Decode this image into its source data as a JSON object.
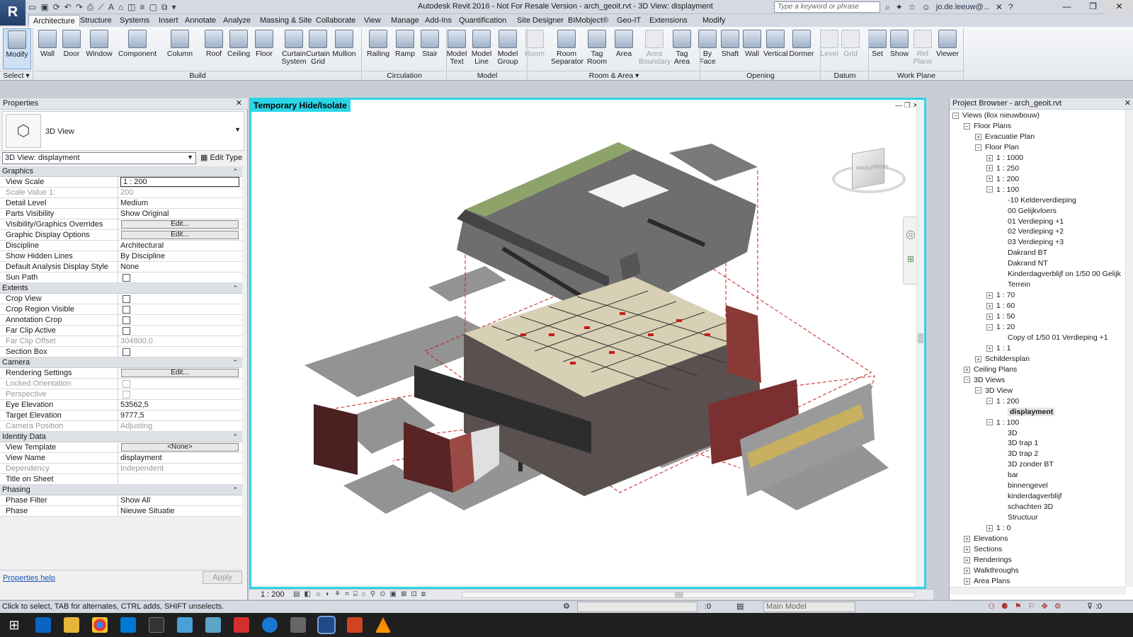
{
  "app": {
    "logo_letter": "R",
    "title": "Autodesk Revit 2016 - Not For Resale Version -    arch_geoit.rvt - 3D View: displayment",
    "search_placeholder": "Type a keyword or phrase",
    "user": "jo.de.leeuw@..."
  },
  "tabs": [
    "Architecture",
    "Structure",
    "Systems",
    "Insert",
    "Annotate",
    "Analyze",
    "Massing & Site",
    "Collaborate",
    "View",
    "Manage",
    "Add-Ins",
    "Quantification",
    "Site Designer",
    "BIMobject®",
    "Geo-IT",
    "Extensions",
    "Modify"
  ],
  "ribbon": {
    "buttons": [
      {
        "label": "Modify",
        "sel": true
      },
      {
        "label": "Wall"
      },
      {
        "label": "Door"
      },
      {
        "label": "Window"
      },
      {
        "label": "Component"
      },
      {
        "label": "Column"
      },
      {
        "label": "Roof"
      },
      {
        "label": "Ceiling"
      },
      {
        "label": "Floor"
      },
      {
        "label": "Curtain\nSystem"
      },
      {
        "label": "Curtain\nGrid"
      },
      {
        "label": "Mullion"
      },
      {
        "label": "Railing"
      },
      {
        "label": "Ramp"
      },
      {
        "label": "Stair"
      },
      {
        "label": "Model\nText"
      },
      {
        "label": "Model\nLine"
      },
      {
        "label": "Model\nGroup"
      },
      {
        "label": "Room",
        "dis": true
      },
      {
        "label": "Room\nSeparator"
      },
      {
        "label": "Tag\nRoom"
      },
      {
        "label": "Area"
      },
      {
        "label": "Area\nBoundary",
        "dis": true
      },
      {
        "label": "Tag\nArea"
      },
      {
        "label": "By\nFace"
      },
      {
        "label": "Shaft"
      },
      {
        "label": "Wall"
      },
      {
        "label": "Vertical"
      },
      {
        "label": "Dormer"
      },
      {
        "label": "Level",
        "dis": true
      },
      {
        "label": "Grid",
        "dis": true
      },
      {
        "label": "Set"
      },
      {
        "label": "Show"
      },
      {
        "label": "Ref\nPlane",
        "dis": true
      },
      {
        "label": "Viewer"
      }
    ],
    "panels": [
      "Select ▾",
      "Build",
      "Circulation",
      "Model",
      "Room & Area ▾",
      "Opening",
      "Datum",
      "Work Plane"
    ]
  },
  "properties": {
    "title": "Properties",
    "type_name": "3D View",
    "selector": "3D View: displayment",
    "edit_type": "Edit Type",
    "sections": {
      "graphics": "Graphics",
      "extents": "Extents",
      "camera": "Camera",
      "identity": "Identity Data",
      "phasing": "Phasing"
    },
    "rows": {
      "view_scale": [
        "View Scale",
        "1 : 200"
      ],
      "scale_value": [
        "Scale Value    1:",
        "200"
      ],
      "detail_level": [
        "Detail Level",
        "Medium"
      ],
      "parts_visibility": [
        "Parts Visibility",
        "Show Original"
      ],
      "vg_overrides": [
        "Visibility/Graphics Overrides",
        "Edit..."
      ],
      "gd_options": [
        "Graphic Display Options",
        "Edit..."
      ],
      "discipline": [
        "Discipline",
        "Architectural"
      ],
      "hidden_lines": [
        "Show Hidden Lines",
        "By Discipline"
      ],
      "analysis_style": [
        "Default Analysis Display Style",
        "None"
      ],
      "sun_path": [
        "Sun Path",
        ""
      ],
      "crop_view": [
        "Crop View",
        ""
      ],
      "crop_region": [
        "Crop Region Visible",
        ""
      ],
      "annotation_crop": [
        "Annotation Crop",
        ""
      ],
      "far_clip_active": [
        "Far Clip Active",
        ""
      ],
      "far_clip_offset": [
        "Far Clip Offset",
        "304800,0"
      ],
      "section_box": [
        "Section Box",
        ""
      ],
      "rendering": [
        "Rendering Settings",
        "Edit..."
      ],
      "locked_orient": [
        "Locked Orientation",
        ""
      ],
      "perspective": [
        "Perspective",
        ""
      ],
      "eye_elev": [
        "Eye Elevation",
        "53562,5"
      ],
      "target_elev": [
        "Target Elevation",
        "9777,5"
      ],
      "camera_pos": [
        "Camera Position",
        "Adjusting"
      ],
      "view_template": [
        "View Template",
        "<None>"
      ],
      "view_name": [
        "View Name",
        "displayment"
      ],
      "dependency": [
        "Dependency",
        "Independent"
      ],
      "title_sheet": [
        "Title on Sheet",
        ""
      ],
      "phase_filter": [
        "Phase Filter",
        "Show All"
      ],
      "phase": [
        "Phase",
        "Nieuwe Situatie"
      ]
    },
    "help": "Properties help",
    "apply": "Apply"
  },
  "viewport": {
    "label": "Temporary Hide/Isolate",
    "scale": "1 : 200",
    "cube_front": "FRONT",
    "cube_right": "RIGHT"
  },
  "browser": {
    "title": "Project Browser - arch_geoit.rvt",
    "nodes": [
      {
        "t": "Views (llox nieuwbouw)",
        "d": 0,
        "pm": "−"
      },
      {
        "t": "Floor Plans",
        "d": 1,
        "pm": "−"
      },
      {
        "t": "Evacuatie Plan",
        "d": 2,
        "pm": "+"
      },
      {
        "t": "Floor Plan",
        "d": 2,
        "pm": "−"
      },
      {
        "t": "1 : 1000",
        "d": 3,
        "pm": "+"
      },
      {
        "t": "1 : 250",
        "d": 3,
        "pm": "+"
      },
      {
        "t": "1 : 200",
        "d": 3,
        "pm": "+"
      },
      {
        "t": "1 : 100",
        "d": 3,
        "pm": "−"
      },
      {
        "t": "-10 Kelderverdieping",
        "d": 4
      },
      {
        "t": "00 Gelijkvloers",
        "d": 4
      },
      {
        "t": "01 Verdieping +1",
        "d": 4
      },
      {
        "t": "02 Verdieping +2",
        "d": 4
      },
      {
        "t": "03 Verdieping +3",
        "d": 4
      },
      {
        "t": "Dakrand BT",
        "d": 4
      },
      {
        "t": "Dakrand NT",
        "d": 4
      },
      {
        "t": "Kinderdagverblijf on 1/50 00 Gelijk",
        "d": 4
      },
      {
        "t": "Terrein",
        "d": 4
      },
      {
        "t": "1 : 70",
        "d": 3,
        "pm": "+"
      },
      {
        "t": "1 : 60",
        "d": 3,
        "pm": "+"
      },
      {
        "t": "1 : 50",
        "d": 3,
        "pm": "+"
      },
      {
        "t": "1 : 20",
        "d": 3,
        "pm": "−"
      },
      {
        "t": "Copy of 1/50 01 Verdieping +1",
        "d": 4
      },
      {
        "t": "1 : 1",
        "d": 3,
        "pm": "+"
      },
      {
        "t": "Schildersplan",
        "d": 2,
        "pm": "+"
      },
      {
        "t": "Ceiling Plans",
        "d": 1,
        "pm": "+"
      },
      {
        "t": "3D Views",
        "d": 1,
        "pm": "−"
      },
      {
        "t": "3D View",
        "d": 2,
        "pm": "−"
      },
      {
        "t": "1 : 200",
        "d": 3,
        "pm": "−"
      },
      {
        "t": "displayment",
        "d": 4,
        "bold": true
      },
      {
        "t": "1 : 100",
        "d": 3,
        "pm": "−"
      },
      {
        "t": "3D",
        "d": 4
      },
      {
        "t": "3D trap 1",
        "d": 4
      },
      {
        "t": "3D trap 2",
        "d": 4
      },
      {
        "t": "3D zonder BT",
        "d": 4
      },
      {
        "t": "bar",
        "d": 4
      },
      {
        "t": "binnengevel",
        "d": 4
      },
      {
        "t": "kinderdagverblijf",
        "d": 4
      },
      {
        "t": "schachten 3D",
        "d": 4
      },
      {
        "t": "Structuur",
        "d": 4
      },
      {
        "t": "1 : 0",
        "d": 3,
        "pm": "+"
      },
      {
        "t": "Elevations",
        "d": 1,
        "pm": "+"
      },
      {
        "t": "Sections",
        "d": 1,
        "pm": "+"
      },
      {
        "t": "Renderings",
        "d": 1,
        "pm": "+"
      },
      {
        "t": "Walkthroughs",
        "d": 1,
        "pm": "+"
      },
      {
        "t": "Area Plans",
        "d": 1,
        "pm": "+"
      }
    ]
  },
  "status": {
    "hint": "Click to select, TAB for alternates, CTRL adds, SHIFT unselects.",
    "coord": ":0",
    "model": "Main Model",
    "filter": ":0"
  }
}
